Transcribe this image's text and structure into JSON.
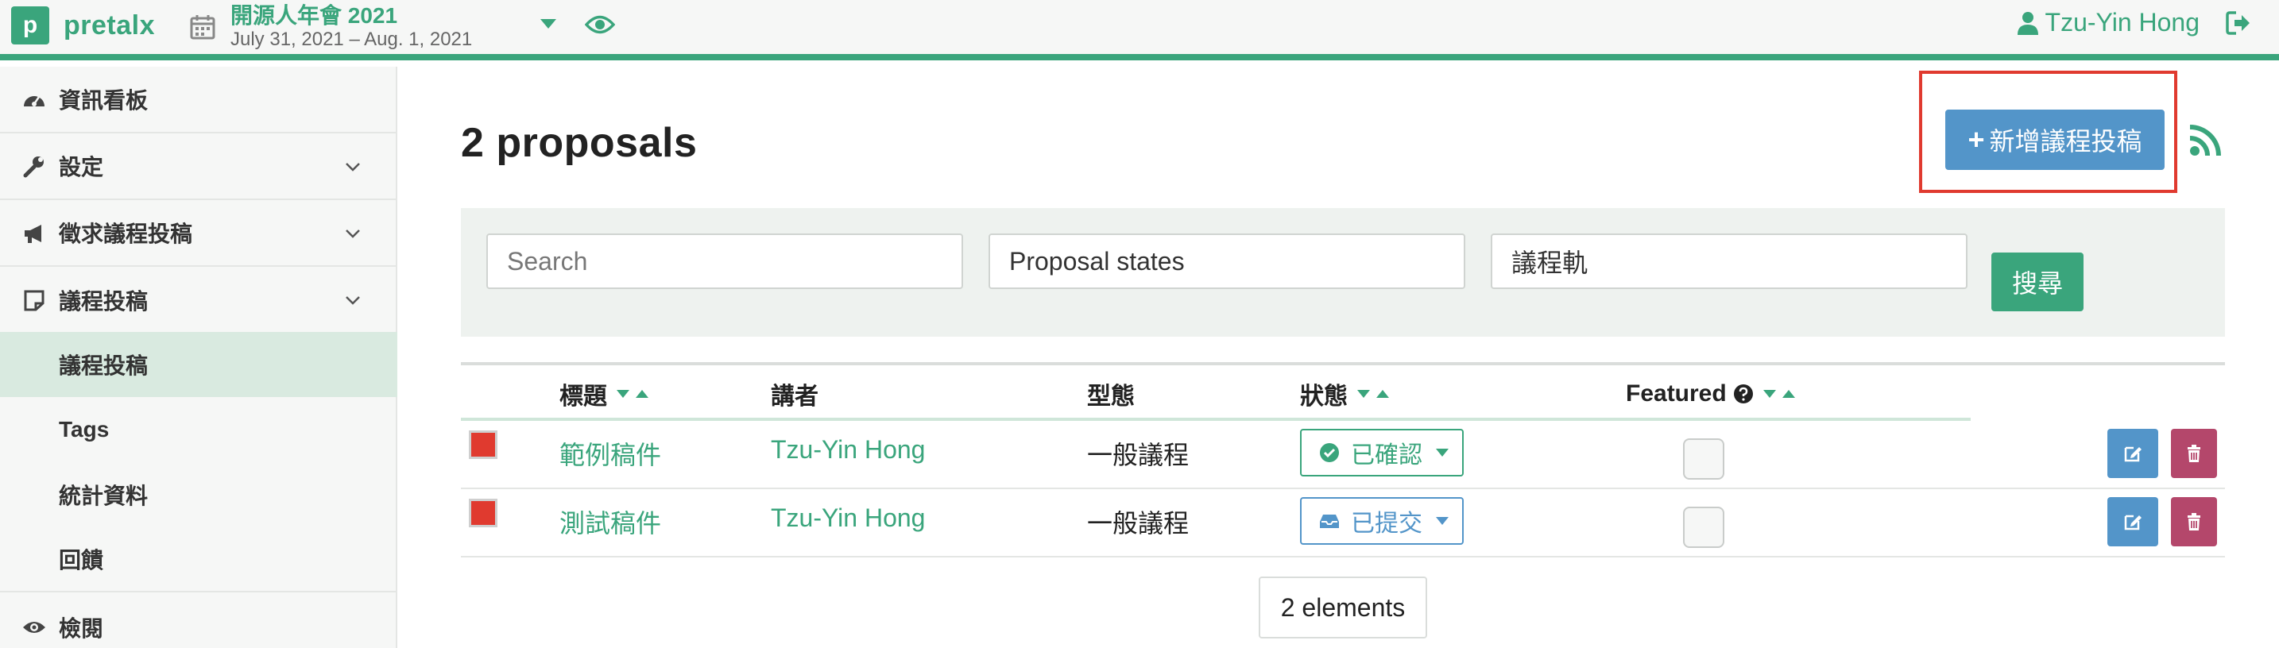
{
  "brand": {
    "logo_letter": "p",
    "name": "pretalx"
  },
  "event": {
    "name": "開源人年會 2021",
    "dates": "July 31, 2021 – Aug. 1, 2021"
  },
  "user": {
    "name": "Tzu-Yin Hong"
  },
  "sidebar": {
    "items": [
      {
        "label": "資訊看板",
        "icon": "dashboard-icon"
      },
      {
        "label": "設定",
        "icon": "wrench-icon"
      },
      {
        "label": "徵求議程投稿",
        "icon": "bullhorn-icon"
      },
      {
        "label": "議程投稿",
        "icon": "sticky-note-icon"
      }
    ],
    "subitems": [
      {
        "label": "議程投稿",
        "active": true
      },
      {
        "label": "Tags"
      },
      {
        "label": "統計資料"
      },
      {
        "label": "回饋"
      }
    ],
    "bottom": {
      "label": "檢閱",
      "icon": "eye-icon"
    }
  },
  "main": {
    "title": "2 proposals",
    "add_button": "新增議程投稿",
    "filters": {
      "search_placeholder": "Search",
      "states_placeholder": "Proposal states",
      "track_placeholder": "議程軌",
      "search_button": "搜尋"
    },
    "table": {
      "headers": {
        "title": "標題",
        "speaker": "講者",
        "type": "型態",
        "state": "狀態",
        "featured": "Featured"
      },
      "rows": [
        {
          "title": "範例稿件",
          "speaker": "Tzu-Yin Hong",
          "type": "一般議程",
          "state": "已確認",
          "state_color": "#3aa57c",
          "state_icon": "check-circle-icon"
        },
        {
          "title": "測試稿件",
          "speaker": "Tzu-Yin Hong",
          "type": "一般議程",
          "state": "已提交",
          "state_color": "#5395c9",
          "state_icon": "inbox-icon"
        }
      ]
    },
    "pagination": "2 elements"
  },
  "colors": {
    "primary": "#3aa57c",
    "info": "#5395c9",
    "danger": "#b4476b",
    "highlight": "#e03a2f"
  }
}
